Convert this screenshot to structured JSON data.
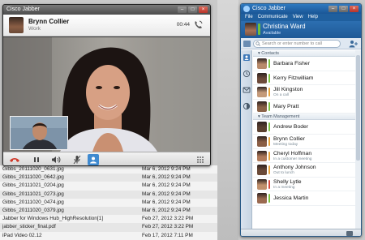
{
  "files": [
    {
      "name": "Gibbs_20111020_0631.jpg",
      "date": "Mar 6, 2012 9:24 PM"
    },
    {
      "name": "Gibbs_20111020_0642.jpg",
      "date": "Mar 6, 2012 9:24 PM"
    },
    {
      "name": "Gibbs_20111021_0204.jpg",
      "date": "Mar 6, 2012 9:24 PM"
    },
    {
      "name": "Gibbs_20111021_0273.jpg",
      "date": "Mar 6, 2012 9:24 PM"
    },
    {
      "name": "Gibbs_20111020_0474.jpg",
      "date": "Mar 6, 2012 9:24 PM"
    },
    {
      "name": "Gibbs_20111020_0379.jpg",
      "date": "Mar 6, 2012 9:24 PM"
    },
    {
      "name": "Jabber for Windows Hub_HighResolution[1]",
      "date": "Feb 27, 2012 3:22 PM"
    },
    {
      "name": "jabber_sticker_final.pdf",
      "date": "Feb 27, 2012 3:22 PM"
    },
    {
      "name": "iPad Video 02.12",
      "date": "Feb 17, 2012 7:11 PM"
    }
  ],
  "call_window": {
    "title": "Cisco Jabber",
    "caller_name": "Brynn Collier",
    "caller_subtitle": "Work",
    "timer": "00:44"
  },
  "jabber": {
    "title": "Cisco Jabber",
    "menu": [
      "File",
      "Communicate",
      "View",
      "Help"
    ],
    "user_name": "Christina Ward",
    "user_status": "Available",
    "search_placeholder": "Search or enter number to call",
    "groups": [
      {
        "title": "Contacts",
        "contacts": [
          {
            "name": "Barbara Fisher",
            "note": "",
            "status_color": "#7cc242",
            "avatar": "#b88a6a"
          },
          {
            "name": "Kerry Fitzwilliam",
            "note": "",
            "status_color": "#7cc242",
            "avatar": "#6c4a3a"
          },
          {
            "name": "Jill Kingston",
            "note": "On a call",
            "status_color": "#e8a33a",
            "avatar": "#c49a7a"
          },
          {
            "name": "Mary Pratt",
            "note": "",
            "status_color": "#7cc242",
            "avatar": "#8a6248"
          }
        ]
      },
      {
        "title": "Team Management",
        "contacts": [
          {
            "name": "Andrew Boder",
            "note": "",
            "status_color": "#7cc242",
            "avatar": "#5a4030"
          },
          {
            "name": "Brynn Collier",
            "note": "Meeting today",
            "status_color": "#e8a33a",
            "avatar": "#8a5e45"
          },
          {
            "name": "Cheryl Hoffman",
            "note": "In a customer meeting",
            "status_color": "#e8a33a",
            "avatar": "#b07a5a"
          },
          {
            "name": "Anthony Johnson",
            "note": "Out to lunch",
            "status_color": "#e8a33a",
            "avatar": "#6a4a38"
          },
          {
            "name": "Shelly Lytle",
            "note": "In a meeting",
            "status_color": "#d9483a",
            "avatar": "#c0906c"
          },
          {
            "name": "Jessica Martin",
            "note": "",
            "status_color": "#7cc242",
            "avatar": "#9a6a50"
          }
        ]
      }
    ]
  },
  "colors": {
    "available": "#7cc242",
    "away": "#e8a33a",
    "busy": "#d9483a",
    "jabber_blue": "#1e5a97",
    "end_call_red": "#d03a2a"
  }
}
